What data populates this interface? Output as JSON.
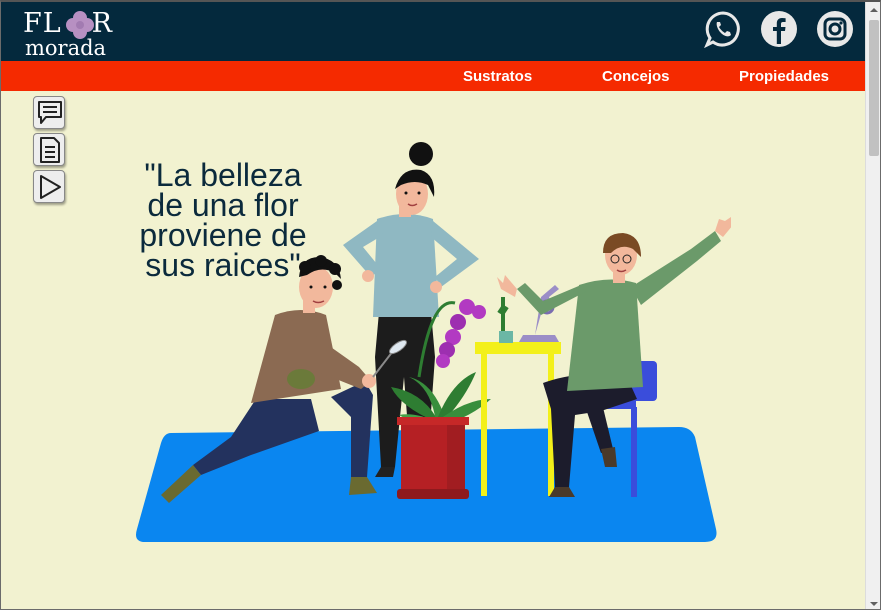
{
  "brand": {
    "logo_line1_left": "FL",
    "logo_line1_right": "R",
    "logo_line2": "morada",
    "flower_color": "#b790c2"
  },
  "social": [
    {
      "name": "WhatsApp",
      "icon": "whatsapp-icon"
    },
    {
      "name": "Facebook",
      "icon": "facebook-icon"
    },
    {
      "name": "Instagram",
      "icon": "instagram-icon"
    }
  ],
  "nav": {
    "items": [
      {
        "label": "Sustratos"
      },
      {
        "label": "Concejos"
      },
      {
        "label": "Propiedades"
      }
    ]
  },
  "tools": [
    {
      "icon": "chat-icon"
    },
    {
      "icon": "document-icon"
    },
    {
      "icon": "play-icon"
    }
  ],
  "hero": {
    "quote_lines": [
      "\"La belleza",
      "de una flor",
      "proviene de",
      "sus raices\""
    ]
  },
  "colors": {
    "topbar": "#04293d",
    "navbar": "#f52a00",
    "page_bg": "#f2f2d0",
    "rug": "#0a86f0"
  }
}
